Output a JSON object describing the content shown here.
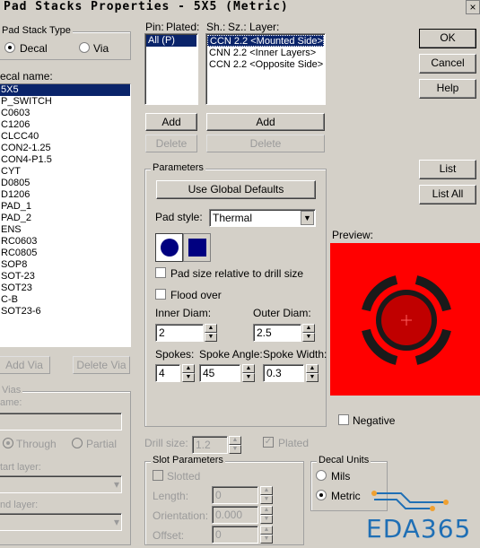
{
  "window": {
    "title": "Pad Stacks Properties - 5X5 (Metric)",
    "close": "×"
  },
  "pad_stack_type": {
    "label": "Pad Stack Type",
    "decal": "Decal",
    "via": "Via",
    "selected": "Decal"
  },
  "decal_name": {
    "label": "ecal name:",
    "items": [
      "5X5",
      "P_SWITCH",
      "C0603",
      "C1206",
      "CLCC40",
      "CON2-1.25",
      "CON4-P1.5",
      "CYT",
      "D0805",
      "D1206",
      "PAD_1",
      "PAD_2",
      "ENS",
      "RC0603",
      "RC0805",
      "SOP8",
      "SOT-23",
      "SOT23",
      "C-B",
      "SOT23-6"
    ]
  },
  "buttons_left": {
    "add_via": "Add Via",
    "delete_via": "Delete Via"
  },
  "vias": {
    "label": "Vias",
    "name_label": "ame:",
    "through": "Through",
    "partial": "Partial",
    "start_layer": "tart layer:",
    "end_layer": "nd layer:"
  },
  "pin_header": {
    "pin": "Pin:",
    "plated": "Plated:"
  },
  "pin_list": [
    "All (P)"
  ],
  "layer_header": {
    "sh": "Sh.:",
    "sz": "Sz.:",
    "layer": "Layer:"
  },
  "layer_list": [
    "CCN 2.2 <Mounted Side>",
    "CNN 2.2 <Inner Layers>",
    "CCN 2.2 <Opposite Side>"
  ],
  "add_delete": {
    "add1": "Add",
    "delete1": "Delete",
    "add2": "Add",
    "delete2": "Delete"
  },
  "parameters": {
    "label": "Parameters",
    "use_global": "Use Global Defaults",
    "pad_style_label": "Pad style:",
    "pad_style_value": "Thermal",
    "pad_size_relative": "Pad size relative to drill size",
    "flood_over": "Flood over",
    "inner_diam_label": "Inner Diam:",
    "inner_diam": "2",
    "outer_diam_label": "Outer Diam:",
    "outer_diam": "2.5",
    "spokes_label": "Spokes:",
    "spokes": "4",
    "spoke_angle_label": "Spoke Angle:",
    "spoke_angle": "45",
    "spoke_width_label": "Spoke Width:",
    "spoke_width": "0.3"
  },
  "drill": {
    "size_label": "Drill size:",
    "size": "1.2",
    "plated": "Plated"
  },
  "slot": {
    "label": "Slot Parameters",
    "slotted": "Slotted",
    "length_label": "Length:",
    "length": "0",
    "orientation_label": "Orientation:",
    "orientation": "0.000",
    "offset_label": "Offset:",
    "offset": "0"
  },
  "right_buttons": {
    "ok": "OK",
    "cancel": "Cancel",
    "help": "Help",
    "list": "List",
    "list_all": "List All"
  },
  "preview": {
    "label": "Preview:",
    "negative": "Negative",
    "bg_color": "#ff0000",
    "ring_color": "#1a1a1a",
    "pad_color": "#c00000"
  },
  "decal_units": {
    "label": "Decal Units",
    "mils": "Mils",
    "metric": "Metric",
    "selected": "Metric"
  },
  "watermark": {
    "text": "EDA365",
    "color": "#1f6fb5"
  }
}
